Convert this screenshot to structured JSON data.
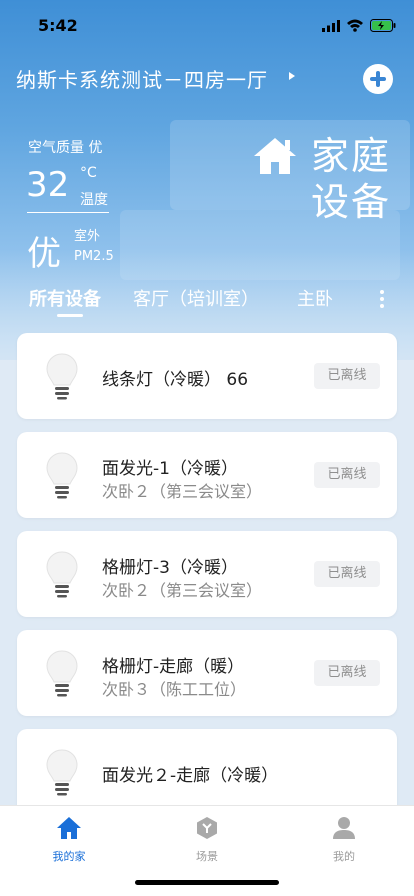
{
  "status_bar": {
    "time": "5:42"
  },
  "header": {
    "home_title": "纳斯卡系统测试－四房一厅"
  },
  "environment": {
    "air_quality_label": "空气质量 优",
    "temperature": "32",
    "temperature_unit": "°C",
    "temperature_label": "温度",
    "aqi": "优",
    "aqi_scope": "室外",
    "aqi_metric": "PM2.5"
  },
  "hero": {
    "line1": "家庭",
    "line2": "设备"
  },
  "tabs": [
    {
      "label": "所有设备",
      "active": true
    },
    {
      "label": "客厅（培训室）",
      "active": false
    },
    {
      "label": "主卧",
      "active": false
    }
  ],
  "devices": [
    {
      "name": "线条灯（冷暖） 66",
      "room": "",
      "status": "已离线",
      "icon": "lightbulb-icon"
    },
    {
      "name": "面发光-1（冷暖）",
      "room": "次卧２（第三会议室）",
      "status": "已离线",
      "icon": "lightbulb-icon"
    },
    {
      "name": "格栅灯-3（冷暖）",
      "room": "次卧２（第三会议室）",
      "status": "已离线",
      "icon": "lightbulb-icon"
    },
    {
      "name": "格栅灯-走廊（暖）",
      "room": "次卧３（陈工工位）",
      "status": "已离线",
      "icon": "lightbulb-icon"
    },
    {
      "name": "面发光２-走廊（冷暖）",
      "room": "",
      "status": "",
      "icon": "lightbulb-icon"
    }
  ],
  "tabbar": [
    {
      "label": "我的家",
      "icon": "home-icon",
      "active": true
    },
    {
      "label": "场景",
      "icon": "scene-icon",
      "active": false
    },
    {
      "label": "我的",
      "icon": "user-icon",
      "active": false
    }
  ],
  "colors": {
    "accent": "#1a6fd8",
    "inactive": "#9b9b9b",
    "hero_top": "#3f8fd6"
  }
}
